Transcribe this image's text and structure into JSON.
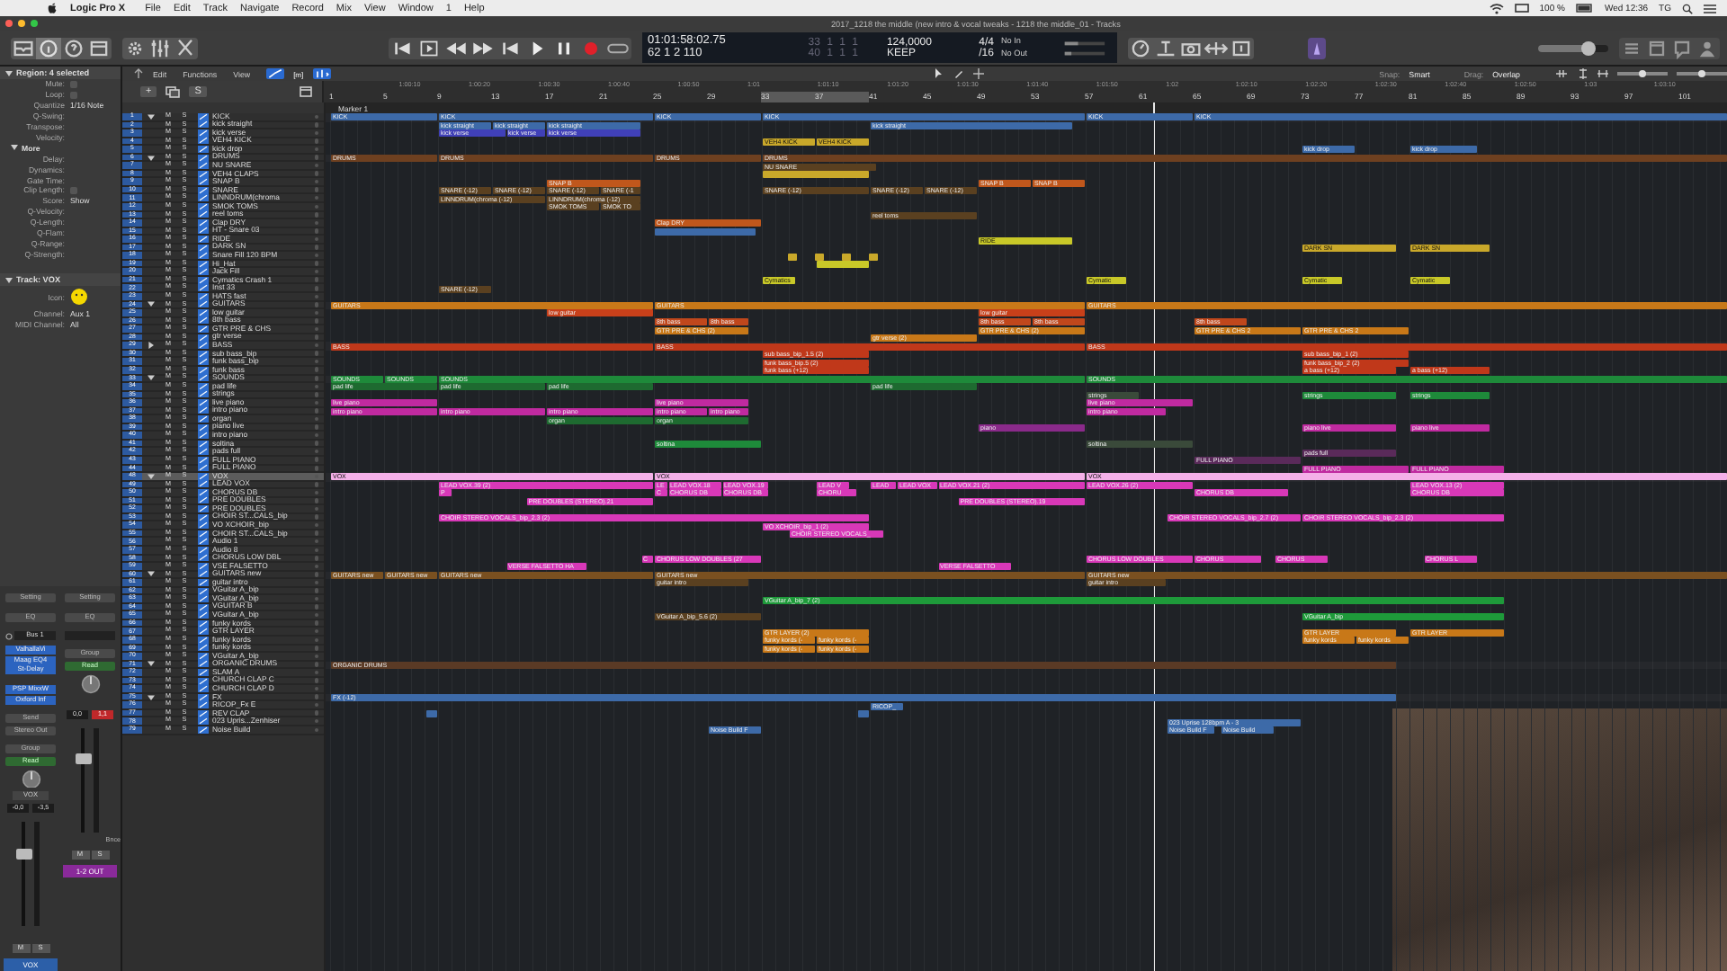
{
  "menu_bar": {
    "app": "Logic Pro X",
    "items": [
      "File",
      "Edit",
      "Track",
      "Navigate",
      "Record",
      "Mix",
      "View",
      "Window",
      "1",
      "Help"
    ],
    "battery": "100 %",
    "clock": "Wed 12:36",
    "user": "TG"
  },
  "window": {
    "title": "2017_1218 the middle (new intro & vocal tweaks - 1218 the middle_01 - Tracks"
  },
  "lcd": {
    "time": "01:01:58:02.75",
    "bars": "62 1 2 110",
    "locator_start": "33 1 1 1",
    "locator_end": "40 1 1 1",
    "tempo": "124,0000",
    "tempo_mode": "KEEP",
    "signature": "4/4",
    "division": "/16",
    "midi_in": "No In",
    "midi_out": "No Out"
  },
  "master_volume": {
    "level": 0.72
  },
  "arrange_toolbar": {
    "menus": [
      "Edit",
      "Functions",
      "View"
    ],
    "mode": "[m]",
    "snap_label": "Snap:",
    "snap": "Smart",
    "drag_label": "Drag:",
    "drag": "Overlap",
    "zoom_sliders": [
      {
        "level": 0.5
      },
      {
        "level": 0.5
      }
    ]
  },
  "track_header_buttons": {
    "add": "+",
    "solo": "S"
  },
  "ruler": {
    "times": [
      "1:00:10",
      "1:00:20",
      "1:00:30",
      "1:00:40",
      "1:00:50",
      "1:01",
      "1:01:10",
      "1:01:20",
      "1:01:30",
      "1:01:40",
      "1:01:50",
      "1:02",
      "1:02:10",
      "1:02:20",
      "1:02:30",
      "1:02:40",
      "1:02:50",
      "1:03",
      "1:03:10"
    ],
    "bars": [
      "1",
      "5",
      "9",
      "13",
      "17",
      "21",
      "25",
      "29",
      "33",
      "37",
      "41",
      "45",
      "49",
      "53",
      "57",
      "61",
      "65",
      "69",
      "73",
      "77",
      "81",
      "85",
      "89",
      "93",
      "97",
      "101"
    ],
    "marker": "Marker 1"
  },
  "inspector": {
    "header": "Region: 4 selected",
    "rows": [
      {
        "label": "Mute:",
        "kind": "checkbox",
        "checked": false
      },
      {
        "label": "Loop:",
        "kind": "checkbox",
        "checked": false
      },
      {
        "label": "Quantize",
        "kind": "value",
        "value": "1/16 Note"
      },
      {
        "label": "Q-Swing:",
        "kind": "value"
      },
      {
        "label": "Transpose:",
        "kind": "value"
      },
      {
        "label": "Velocity:",
        "kind": "value"
      }
    ],
    "more": "More",
    "more_rows": [
      {
        "label": "Delay:",
        "kind": "value"
      },
      {
        "label": "Dynamics:",
        "kind": "value"
      },
      {
        "label": "Gate Time:",
        "kind": "value"
      },
      {
        "label": "Clip Length:",
        "kind": "checkbox",
        "checked": false
      },
      {
        "label": "Score:",
        "kind": "value",
        "value": "Show"
      },
      {
        "label": "Q-Velocity:",
        "kind": "value"
      },
      {
        "label": "Q-Length:",
        "kind": "value"
      },
      {
        "label": "Q-Flam:",
        "kind": "value"
      },
      {
        "label": "Q-Range:",
        "kind": "value"
      },
      {
        "label": "Q-Strength:",
        "kind": "value"
      }
    ],
    "track_header": "Track: VOX",
    "icon_label": "Icon:",
    "track_rows": [
      {
        "label": "Channel:",
        "value": "Aux 1"
      },
      {
        "label": "MIDI Channel:",
        "value": "All"
      }
    ]
  },
  "mixer": [
    {
      "setting": "Setting",
      "eq": "EQ",
      "input": "Bus 1",
      "plugin_groups": [
        [
          "ValhallaVi",
          "Maag EQ4",
          "St-Delay"
        ],
        [
          "PSP MixxW",
          "Oxford Inf"
        ]
      ],
      "send": "Send",
      "output": "Stereo Out",
      "group": "Group",
      "automation": "Read",
      "short_name": "VOX",
      "volume": "-0,0",
      "peak": "-3,5",
      "clipping": false,
      "level": 0.7,
      "m": "M",
      "s": "S",
      "name": "VOX",
      "color": "#2c5fa8"
    },
    {
      "setting": "Setting",
      "eq": "EQ",
      "group": "Group",
      "automation": "Read",
      "volume": "0,0",
      "peak": "1,1",
      "clipping": true,
      "bounce": "Bnce",
      "level": 0.7,
      "m": "M",
      "s": "S",
      "name": "1-2 OUT",
      "color": "#8a2a9a"
    }
  ],
  "tracks": [
    {
      "number": "1",
      "name": "KICK",
      "kind": "folder",
      "expanded": true,
      "selected": false,
      "m": "M",
      "s": "S",
      "regions": [
        {
          "label": "KICK",
          "color": "#3d6aa8"
        },
        {
          "label": "KICK",
          "color": "#3d6aa8"
        },
        {
          "label": "KICK",
          "color": "#3d6aa8"
        },
        {
          "label": "KICK",
          "color": "#3d6aa8"
        },
        {
          "label": "KICK",
          "color": "#3d6aa8"
        },
        {
          "label": "KICK",
          "color": "#3d6aa8"
        }
      ]
    },
    {
      "number": "2",
      "name": "kick straight",
      "kind": "track",
      "selected": false,
      "m": "M",
      "s": "S",
      "regions": [
        {
          "label": "kick straight",
          "color": "#3d6aa8"
        },
        {
          "label": "kick straight",
          "color": "#3d6aa8"
        },
        {
          "label": "kick straight",
          "color": "#3d6aa8"
        },
        {
          "label": "kick straight",
          "color": "#3d6aa8"
        }
      ]
    },
    {
      "number": "3",
      "name": "kick verse",
      "kind": "track",
      "selected": false,
      "m": "M",
      "s": "S",
      "regions": [
        {
          "label": "kick verse",
          "color": "#4040b8"
        },
        {
          "label": "kick verse",
          "color": "#4040b8"
        },
        {
          "label": "kick verse",
          "color": "#4040b8"
        }
      ]
    },
    {
      "number": "4",
      "name": "VEH4 KICK",
      "kind": "track",
      "selected": false,
      "m": "M",
      "s": "S",
      "regions": [
        {
          "label": "VEH4 KICK",
          "color": "#c9a82a"
        },
        {
          "label": "VEH4 KICK",
          "color": "#c9a82a"
        }
      ]
    },
    {
      "number": "5",
      "name": "kick drop",
      "kind": "track",
      "selected": false,
      "m": "M",
      "s": "S",
      "regions": [
        {
          "label": "kick drop",
          "color": "#3d6aa8"
        },
        {
          "label": "kick drop",
          "color": "#3d6aa8"
        }
      ]
    },
    {
      "number": "6",
      "name": "DRUMS",
      "kind": "folder",
      "expanded": true,
      "selected": false,
      "m": "M",
      "s": "S",
      "regions": [
        {
          "label": "DRUMS",
          "color": "#6e4020"
        },
        {
          "label": "DRUMS",
          "color": "#6e4020"
        },
        {
          "label": "DRUMS",
          "color": "#6e4020"
        },
        {
          "label": "DRUMS",
          "color": "#6e4020"
        }
      ]
    },
    {
      "number": "7",
      "name": "NU SNARE",
      "kind": "track",
      "selected": false,
      "m": "M",
      "s": "S",
      "regions": [
        {
          "label": "NU SNARE",
          "color": "#5a4020"
        }
      ]
    },
    {
      "number": "8",
      "name": "VEH4 CLAPS",
      "kind": "track",
      "selected": false,
      "m": "M",
      "s": "S",
      "regions": [
        {
          "color": "#c9a82a"
        }
      ]
    },
    {
      "number": "9",
      "name": "SNAP B",
      "kind": "track",
      "selected": false,
      "m": "M",
      "s": "S",
      "regions": [
        {
          "label": "SNAP B",
          "color": "#c0571c"
        },
        {
          "label": "SNAP B",
          "color": "#c0571c"
        },
        {
          "label": "SNAP B",
          "color": "#c0571c"
        }
      ]
    },
    {
      "number": "10",
      "name": "SNARE",
      "kind": "track",
      "selected": false,
      "m": "M",
      "s": "S",
      "regions": [
        {
          "label": "SNARE (-12)",
          "color": "#5a4020"
        },
        {
          "label": "SNARE (-12)",
          "color": "#5a4020"
        },
        {
          "label": "SNARE (-12)",
          "color": "#5a4020"
        },
        {
          "label": "SNARE (-1",
          "color": "#5a4020"
        },
        {
          "label": "SNARE (-12)",
          "color": "#5a4020"
        },
        {
          "label": "SNARE (-12)",
          "color": "#5a4020"
        },
        {
          "label": "SNARE (-12)",
          "color": "#5a4020"
        }
      ]
    },
    {
      "number": "11",
      "name": "LINNDRUM(chroma",
      "kind": "track",
      "selected": false,
      "m": "M",
      "s": "S",
      "regions": [
        {
          "label": "LINNDRUM(chroma (-12)",
          "color": "#5a4020"
        },
        {
          "label": "LINNDRUM(chroma (-12)",
          "color": "#5a4020"
        }
      ]
    },
    {
      "number": "12",
      "name": "SMOK TOMS",
      "kind": "track",
      "selected": false,
      "m": "M",
      "s": "S",
      "regions": [
        {
          "label": "SMOK TOMS",
          "color": "#5a4020"
        },
        {
          "label": "SMOK TO",
          "color": "#5a4020"
        }
      ]
    },
    {
      "number": "13",
      "name": "reel toms",
      "kind": "track",
      "selected": false,
      "m": "M",
      "s": "S",
      "regions": [
        {
          "label": "reel toms",
          "color": "#5a4020"
        }
      ]
    },
    {
      "number": "14",
      "name": "Clap DRY",
      "kind": "track",
      "selected": false,
      "m": "M",
      "s": "S",
      "regions": [
        {
          "label": "Clap DRY",
          "color": "#c0571c"
        }
      ]
    },
    {
      "number": "15",
      "name": "HT - Snare 03",
      "kind": "track",
      "selected": false,
      "m": "M",
      "s": "S",
      "regions": [
        {
          "color": "#3d6aa8"
        }
      ]
    },
    {
      "number": "16",
      "name": "RIDE",
      "kind": "track",
      "selected": false,
      "m": "M",
      "s": "S",
      "regions": [
        {
          "label": "RIDE",
          "color": "#c8c828"
        }
      ]
    },
    {
      "number": "17",
      "name": "DARK SN",
      "kind": "track",
      "selected": false,
      "m": "M",
      "s": "S",
      "regions": [
        {
          "label": "DARK SN",
          "color": "#c9a82a"
        },
        {
          "label": "DARK SN",
          "color": "#c9a82a"
        }
      ]
    },
    {
      "number": "18",
      "name": "Snare Fill 120 BPM",
      "kind": "track",
      "selected": false,
      "m": "M",
      "s": "S",
      "regions": [
        {
          "color": "#c9a82a"
        },
        {
          "color": "#c9a82a"
        },
        {
          "color": "#c9a82a"
        },
        {
          "color": "#c9a82a"
        }
      ]
    },
    {
      "number": "19",
      "name": "Hi_Hat",
      "kind": "track",
      "selected": false,
      "m": "M",
      "s": "S",
      "regions": [
        {
          "color": "#c8c828"
        }
      ]
    },
    {
      "number": "20",
      "name": "Jack Fill",
      "kind": "track",
      "selected": false,
      "m": "M",
      "s": "S"
    },
    {
      "number": "21",
      "name": "Cymatics Crash 1",
      "kind": "track",
      "selected": false,
      "m": "M",
      "s": "S",
      "regions": [
        {
          "label": "Cymatics",
          "color": "#c8c828"
        },
        {
          "label": "Cymatic",
          "color": "#c8c828"
        },
        {
          "label": "Cymatic",
          "color": "#c8c828"
        },
        {
          "label": "Cymatic",
          "color": "#c8c828"
        }
      ]
    },
    {
      "number": "22",
      "name": "Inst 33",
      "kind": "track",
      "selected": false,
      "m": "M",
      "s": "S",
      "regions": [
        {
          "label": "SNARE (-12)",
          "color": "#5a4020"
        }
      ]
    },
    {
      "number": "23",
      "name": "HATS fast",
      "kind": "track",
      "selected": false,
      "m": "M",
      "s": "S"
    },
    {
      "number": "24",
      "name": "GUITARS",
      "kind": "folder",
      "expanded": true,
      "selected": false,
      "m": "M",
      "s": "S",
      "regions": [
        {
          "label": "GUITARS",
          "color": "#c87818"
        },
        {
          "label": "GUITARS",
          "color": "#c87818"
        },
        {
          "label": "GUITARS",
          "color": "#c87818"
        }
      ]
    },
    {
      "number": "25",
      "name": "low guitar",
      "kind": "track",
      "selected": false,
      "m": "M",
      "s": "S",
      "regions": [
        {
          "label": "low guitar",
          "color": "#c8401a"
        },
        {
          "label": "low guitar",
          "color": "#c8401a"
        }
      ]
    },
    {
      "number": "26",
      "name": "8th bass",
      "kind": "track",
      "selected": false,
      "m": "M",
      "s": "S",
      "regions": [
        {
          "label": "8th bass",
          "color": "#c0471c"
        },
        {
          "label": "8th bass",
          "color": "#c0471c"
        },
        {
          "label": "8th bass",
          "color": "#c0471c"
        },
        {
          "label": "8th bass",
          "color": "#c0471c"
        },
        {
          "label": "8th bass",
          "color": "#c0471c"
        }
      ]
    },
    {
      "number": "27",
      "name": "GTR PRE & CHS",
      "kind": "track",
      "selected": false,
      "m": "M",
      "s": "S",
      "regions": [
        {
          "label": "GTR PRE & CHS  (2)",
          "color": "#c87818"
        },
        {
          "label": "GTR PRE & CHS  (2)",
          "color": "#c87818"
        },
        {
          "label": "GTR PRE & CHS 2",
          "color": "#c87818"
        },
        {
          "label": "GTR PRE & CHS 2",
          "color": "#c87818"
        }
      ]
    },
    {
      "number": "28",
      "name": "gtr verse",
      "kind": "track",
      "selected": false,
      "m": "M",
      "s": "S",
      "regions": [
        {
          "label": "gtr verse  (2)",
          "color": "#c87818"
        }
      ]
    },
    {
      "number": "29",
      "name": "BASS",
      "kind": "folder",
      "expanded": false,
      "selected": false,
      "m": "M",
      "s": "S",
      "regions": [
        {
          "label": "BASS",
          "color": "#c0381a"
        },
        {
          "label": "BASS",
          "color": "#c0381a"
        },
        {
          "label": "BASS",
          "color": "#c0381a"
        }
      ]
    },
    {
      "number": "30",
      "name": "sub bass_bip",
      "kind": "track",
      "selected": false,
      "m": "M",
      "s": "S",
      "regions": [
        {
          "label": "sub bass_bip_1.5  (2)",
          "color": "#c0381a"
        },
        {
          "label": "sub bass_bip_1  (2)",
          "color": "#c0381a"
        }
      ]
    },
    {
      "number": "31",
      "name": "funk bass_bip",
      "kind": "track",
      "selected": false,
      "m": "M",
      "s": "S",
      "regions": [
        {
          "label": "funk bass_bip.5  (2)",
          "color": "#c0381a"
        },
        {
          "label": "funk bass_bip_2  (2)",
          "color": "#c0381a"
        }
      ]
    },
    {
      "number": "32",
      "name": "funk bass",
      "kind": "track",
      "selected": false,
      "m": "M",
      "s": "S",
      "regions": [
        {
          "label": "funk bass (+12)",
          "color": "#c0381a"
        },
        {
          "label": "a bass (+12)",
          "color": "#c0381a"
        },
        {
          "label": "a bass (+12)",
          "color": "#c0381a"
        }
      ]
    },
    {
      "number": "33",
      "name": "SOUNDS",
      "kind": "folder",
      "expanded": true,
      "selected": false,
      "m": "M",
      "s": "S",
      "regions": [
        {
          "label": "SOUNDS",
          "color": "#1e8a3a"
        },
        {
          "label": "SOUNDS",
          "color": "#1e8a3a"
        },
        {
          "label": "SOUNDS",
          "color": "#1e8a3a"
        },
        {
          "label": "SOUNDS",
          "color": "#1e8a3a"
        }
      ]
    },
    {
      "number": "34",
      "name": "pad life",
      "kind": "track",
      "selected": false,
      "m": "M",
      "s": "S",
      "regions": [
        {
          "label": "pad life",
          "color": "#1e6a30"
        },
        {
          "label": "pad life",
          "color": "#1e6a30"
        },
        {
          "label": "pad life",
          "color": "#1e6a30"
        },
        {
          "label": "pad life",
          "color": "#1e6a30"
        }
      ]
    },
    {
      "number": "35",
      "name": "strings",
      "kind": "track",
      "selected": false,
      "m": "M",
      "s": "S",
      "regions": [
        {
          "label": "strings",
          "color": "#3a4a3a"
        },
        {
          "label": "strings",
          "color": "#1e8a3a"
        },
        {
          "label": "strings",
          "color": "#1e8a3a"
        }
      ]
    },
    {
      "number": "36",
      "name": "live piano",
      "kind": "track",
      "selected": false,
      "m": "M",
      "s": "S",
      "regions": [
        {
          "label": "live piano",
          "color": "#c02aa0"
        },
        {
          "label": "live piano",
          "color": "#c02aa0"
        },
        {
          "label": "live piano",
          "color": "#c02aa0"
        }
      ]
    },
    {
      "number": "37",
      "name": "intro piano",
      "kind": "track",
      "selected": false,
      "m": "M",
      "s": "S",
      "regions": [
        {
          "label": "intro piano",
          "color": "#c02aa0"
        },
        {
          "label": "intro piano",
          "color": "#c02aa0"
        },
        {
          "label": "intro piano",
          "color": "#c02aa0"
        },
        {
          "label": "intro piano",
          "color": "#c02aa0"
        },
        {
          "label": "intro piano",
          "color": "#c02aa0"
        },
        {
          "label": "intro piano",
          "color": "#c02aa0"
        }
      ]
    },
    {
      "number": "38",
      "name": "organ",
      "kind": "track",
      "selected": false,
      "m": "M",
      "s": "S",
      "regions": [
        {
          "label": "organ",
          "color": "#1e6a30"
        },
        {
          "label": "organ",
          "color": "#1e6a30"
        }
      ]
    },
    {
      "number": "39",
      "name": "piano live",
      "kind": "track",
      "selected": false,
      "m": "M",
      "s": "S",
      "regions": [
        {
          "label": "piano",
          "color": "#8a2a8a"
        },
        {
          "label": "piano live",
          "color": "#c02aa0"
        },
        {
          "label": "piano live",
          "color": "#c02aa0"
        }
      ]
    },
    {
      "number": "40",
      "name": "intro piano",
      "kind": "track",
      "selected": false,
      "m": "M",
      "s": "S"
    },
    {
      "number": "41",
      "name": "soltina",
      "kind": "track",
      "selected": false,
      "m": "M",
      "s": "S",
      "regions": [
        {
          "label": "soltina",
          "color": "#1e8a3a"
        },
        {
          "label": "soltina",
          "color": "#3a4a3a"
        }
      ]
    },
    {
      "number": "42",
      "name": "pads full",
      "kind": "track",
      "selected": false,
      "m": "M",
      "s": "S",
      "regions": [
        {
          "label": "pads full",
          "color": "#5a2a5a"
        }
      ]
    },
    {
      "number": "43",
      "name": "FULL PIANO",
      "kind": "track",
      "selected": false,
      "m": "M",
      "s": "S",
      "regions": [
        {
          "label": "FULL PIANO",
          "color": "#5a2a5a"
        }
      ]
    },
    {
      "number": "44",
      "name": "FULL PIANO",
      "kind": "track",
      "selected": false,
      "m": "M",
      "s": "S",
      "regions": [
        {
          "label": "FULL PIANO",
          "color": "#c02aa0"
        },
        {
          "label": "FULL PIANO",
          "color": "#c02aa0"
        }
      ]
    },
    {
      "number": "48",
      "name": "VOX",
      "kind": "folder",
      "expanded": true,
      "selected": true,
      "m": "M",
      "s": "S",
      "regions": [
        {
          "label": "VOX",
          "color": "#f4b0e8"
        },
        {
          "label": "VOX",
          "color": "#f4b0e8"
        },
        {
          "label": "VOX",
          "color": "#f4b0e8"
        }
      ]
    },
    {
      "number": "49",
      "name": "LEAD VOX",
      "kind": "track",
      "selected": false,
      "m": "M",
      "s": "S",
      "regions": [
        {
          "label": "LEAD VOX.39  (2)",
          "color": "#d838b8"
        },
        {
          "label": "LE",
          "color": "#d838b8"
        },
        {
          "label": "LEAD VOX.18",
          "color": "#d838b8"
        },
        {
          "label": "LEAD VOX.19",
          "color": "#d838b8"
        },
        {
          "label": "LEAD V",
          "color": "#d838b8"
        },
        {
          "label": "LEAD",
          "color": "#d838b8"
        },
        {
          "label": "LEAD VOX",
          "color": "#d838b8"
        },
        {
          "label": "LEAD VOX.21  (2)",
          "color": "#d838b8"
        },
        {
          "label": "LEAD VOX.26  (2)",
          "color": "#d838b8"
        },
        {
          "label": "LEAD VOX.13  (2)",
          "color": "#d838b8"
        }
      ]
    },
    {
      "number": "50",
      "name": "CHORUS DB",
      "kind": "track",
      "selected": false,
      "m": "M",
      "s": "S",
      "regions": [
        {
          "label": "P",
          "color": "#d838b8"
        },
        {
          "label": "C",
          "color": "#d838b8"
        },
        {
          "label": "CHORUS DB",
          "color": "#d838b8"
        },
        {
          "label": "CHORUS DB",
          "color": "#d838b8"
        },
        {
          "label": "CHORU",
          "color": "#d838b8"
        },
        {
          "label": "CHORUS DB",
          "color": "#d838b8"
        },
        {
          "label": "CHORUS DB",
          "color": "#d838b8"
        }
      ]
    },
    {
      "number": "51",
      "name": "PRE DOUBLES",
      "kind": "track",
      "selected": false,
      "m": "M",
      "s": "S",
      "regions": [
        {
          "label": "PRE DOUBLES (STEREO).21",
          "color": "#d838b8"
        },
        {
          "label": "PRE DOUBLES (STEREO).19",
          "color": "#d838b8"
        }
      ]
    },
    {
      "number": "52",
      "name": "PRE DOUBLES",
      "kind": "track",
      "selected": false,
      "m": "M",
      "s": "S"
    },
    {
      "number": "53",
      "name": "CHOIR ST...CALS_bip",
      "kind": "track",
      "selected": false,
      "m": "M",
      "s": "S",
      "regions": [
        {
          "label": "CHOIR STEREO VOCALS_bip_2.3  (2)",
          "color": "#d838b8"
        },
        {
          "label": "CHOIR STEREO VOCALS_bip_2.7  (2)",
          "color": "#d838b8"
        },
        {
          "label": "CHOIR STEREO VOCALS_bip_2.3  (2)",
          "color": "#d838b8"
        }
      ]
    },
    {
      "number": "54",
      "name": "VO XCHOIR_bip",
      "kind": "track",
      "selected": false,
      "m": "M",
      "s": "S",
      "regions": [
        {
          "label": "VO XCHOIR_bip_1  (2)",
          "color": "#d838b8"
        }
      ]
    },
    {
      "number": "55",
      "name": "CHOIR ST...CALS_bip",
      "kind": "track",
      "selected": false,
      "m": "M",
      "s": "S",
      "regions": [
        {
          "label": "CHOIR STEREO VOCALS_",
          "color": "#d838b8"
        }
      ]
    },
    {
      "number": "56",
      "name": "Audio 1",
      "kind": "track",
      "selected": false,
      "m": "M",
      "s": "S"
    },
    {
      "number": "57",
      "name": "Audio 8",
      "kind": "track",
      "selected": false,
      "m": "M",
      "s": "S"
    },
    {
      "number": "58",
      "name": "CHORUS LOW DBL",
      "kind": "track",
      "selected": false,
      "m": "M",
      "s": "S",
      "regions": [
        {
          "label": "C",
          "color": "#d838b8"
        },
        {
          "label": "CHORUS LOW DOUBLES (27",
          "color": "#d838b8"
        },
        {
          "label": "CHORUS LOW DOUBLES",
          "color": "#d838b8"
        },
        {
          "label": "CHORUS",
          "color": "#d838b8"
        },
        {
          "label": "CHORUS",
          "color": "#d838b8"
        },
        {
          "label": "CHORUS L",
          "color": "#d838b8"
        }
      ]
    },
    {
      "number": "59",
      "name": "VSE FALSETTO",
      "kind": "track",
      "selected": false,
      "m": "M",
      "s": "S",
      "regions": [
        {
          "label": "VERSE FALSETTO HA",
          "color": "#d838b8"
        },
        {
          "label": "VERSE FALSETTO",
          "color": "#d838b8"
        }
      ]
    },
    {
      "number": "60",
      "name": "GUITARS new",
      "kind": "folder",
      "expanded": true,
      "selected": false,
      "m": "M",
      "s": "S",
      "regions": [
        {
          "label": "GUITARS new",
          "color": "#7a5020"
        },
        {
          "label": "GUITARS new",
          "color": "#7a5020"
        },
        {
          "label": "GUITARS new",
          "color": "#7a5020"
        },
        {
          "label": "GUITARS new",
          "color": "#7a5020"
        },
        {
          "label": "GUITARS new",
          "color": "#7a5020"
        }
      ]
    },
    {
      "number": "61",
      "name": "guitar intro",
      "kind": "track",
      "selected": false,
      "m": "M",
      "s": "S",
      "regions": [
        {
          "label": "guitar intro",
          "color": "#5a4020"
        },
        {
          "label": "guitar intro",
          "color": "#5a4020"
        }
      ]
    },
    {
      "number": "62",
      "name": "VGuitar A_bip",
      "kind": "track",
      "selected": false,
      "m": "M",
      "s": "S"
    },
    {
      "number": "63",
      "name": "VGuitar A_bip",
      "kind": "track",
      "selected": false,
      "m": "M",
      "s": "S",
      "regions": [
        {
          "label": "VGuitar A_bip_7  (2)",
          "color": "#1e9a3a"
        }
      ]
    },
    {
      "number": "64",
      "name": "VGUITAR B",
      "kind": "track",
      "selected": false,
      "m": "M",
      "s": "S"
    },
    {
      "number": "65",
      "name": "VGuitar A_bip",
      "kind": "track",
      "selected": false,
      "m": "M",
      "s": "S",
      "regions": [
        {
          "label": "VGuitar A_bip_5.6  (2)",
          "color": "#5a4020"
        },
        {
          "label": "VGuitar A_bip",
          "color": "#1e9a3a"
        }
      ]
    },
    {
      "number": "66",
      "name": "funky kords",
      "kind": "track",
      "selected": false,
      "m": "M",
      "s": "S"
    },
    {
      "number": "67",
      "name": "GTR LAYER",
      "kind": "track",
      "selected": false,
      "m": "M",
      "s": "S",
      "regions": [
        {
          "label": "GTR LAYER  (2)",
          "color": "#c87818"
        },
        {
          "label": "GTR LAYER",
          "color": "#c87818"
        },
        {
          "label": "GTR LAYER",
          "color": "#c87818"
        }
      ]
    },
    {
      "number": "68",
      "name": "funky kords",
      "kind": "track",
      "selected": false,
      "m": "M",
      "s": "S",
      "regions": [
        {
          "label": "funky kords (-",
          "color": "#c87818"
        },
        {
          "label": "funky kords (-",
          "color": "#c87818"
        },
        {
          "label": "funky kords",
          "color": "#c87818"
        },
        {
          "label": "funky kords",
          "color": "#c87818"
        }
      ]
    },
    {
      "number": "69",
      "name": "funky kords",
      "kind": "track",
      "selected": false,
      "m": "M",
      "s": "S",
      "regions": [
        {
          "label": "funky kords (-",
          "color": "#c87818"
        },
        {
          "label": "funky kords (-",
          "color": "#c87818"
        }
      ]
    },
    {
      "number": "70",
      "name": "VGuitar A_bip",
      "kind": "track",
      "selected": false,
      "m": "M",
      "s": "S"
    },
    {
      "number": "71",
      "name": "ORGANIC DRUMS",
      "kind": "folder",
      "expanded": true,
      "selected": false,
      "m": "M",
      "s": "S",
      "regions": [
        {
          "label": "ORGANIC DRUMS",
          "color": "#5a3a25"
        }
      ]
    },
    {
      "number": "72",
      "name": "SLAM A",
      "kind": "track",
      "selected": false,
      "m": "M",
      "s": "S"
    },
    {
      "number": "73",
      "name": "CHURCH CLAP C",
      "kind": "track",
      "selected": false,
      "m": "M",
      "s": "S"
    },
    {
      "number": "74",
      "name": "CHURCH CLAP D",
      "kind": "track",
      "selected": false,
      "m": "M",
      "s": "S"
    },
    {
      "number": "75",
      "name": "FX",
      "kind": "folder",
      "expanded": true,
      "selected": false,
      "m": "M",
      "s": "S",
      "regions": [
        {
          "label": "FX (-12)",
          "color": "#3d6aa8"
        }
      ]
    },
    {
      "number": "76",
      "name": "RICOP_Fx E",
      "kind": "track",
      "selected": false,
      "m": "M",
      "s": "S",
      "regions": [
        {
          "label": "RICOP_",
          "color": "#3d6aa8"
        }
      ]
    },
    {
      "number": "77",
      "name": "REV CLAP",
      "kind": "track",
      "selected": false,
      "m": "M",
      "s": "S",
      "regions": [
        {
          "color": "#3d6aa8"
        },
        {
          "color": "#3d6aa8"
        }
      ]
    },
    {
      "number": "78",
      "name": "023 Upris...Zenhiser",
      "kind": "track",
      "selected": false,
      "m": "M",
      "s": "S",
      "regions": [
        {
          "label": "023 Uprise 128bpm A - 3",
          "color": "#3d6aa8"
        }
      ]
    },
    {
      "number": "79",
      "name": "Noise Build",
      "kind": "track",
      "selected": false,
      "m": "M",
      "s": "S",
      "regions": [
        {
          "label": "Noise Build F",
          "color": "#3d6aa8"
        },
        {
          "label": "Noise Build F",
          "color": "#3d6aa8"
        },
        {
          "label": "Noise Build",
          "color": "#3d6aa8"
        }
      ]
    }
  ]
}
